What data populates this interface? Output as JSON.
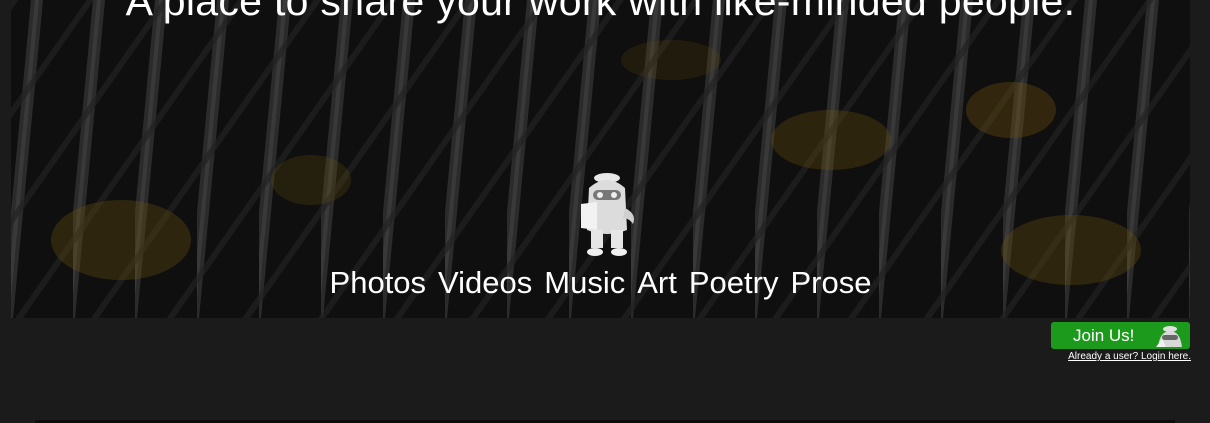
{
  "hero": {
    "tagline": "A place to share your work with like-minded people.",
    "categories": [
      "Photos",
      "Videos",
      "Music",
      "Art",
      "Poetry",
      "Prose"
    ]
  },
  "actions": {
    "join_label": "Join Us!",
    "login_label": "Already a user? Login here."
  },
  "colors": {
    "background": "#1b1b1b",
    "join_button": "#1c9a1c",
    "text": "#ffffff"
  },
  "icons": {
    "mascot": "beret-mascot-icon",
    "join": "mascot-head-icon"
  }
}
